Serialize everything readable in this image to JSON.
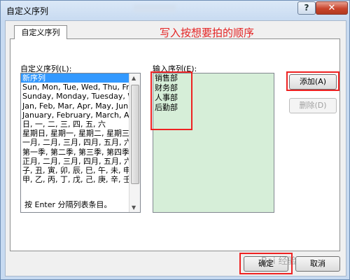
{
  "window": {
    "title": "自定义序列"
  },
  "titlebar_buttons": {
    "help": "?",
    "close": "✕"
  },
  "tab": {
    "label": "自定义序列"
  },
  "annotation": "写入按想要拍的顺序",
  "left_list": {
    "label": "自定义序列(L):",
    "items": [
      "新序列",
      "Sun, Mon, Tue, Wed, Thu, Fri, Sa",
      "Sunday, Monday, Tuesday, Wedne",
      "Jan, Feb, Mar, Apr, May, Jun, Ju",
      "January, February, March, April,",
      "日, 一, 二, 三, 四, 五, 六",
      "星期日, 星期一, 星期二, 星期三, 星",
      "一月, 二月, 三月, 四月, 五月, 六月,",
      "第一季, 第二季, 第三季, 第四季",
      "正月, 二月, 三月, 四月, 五月, 六月,",
      "子, 丑, 寅, 卯, 辰, 巳, 午, 未, 申, 酉",
      "甲, 乙, 丙, 丁, 戊, 己, 庚, 辛, 壬, 癸"
    ],
    "selected_index": 0
  },
  "entries": {
    "label": "输入序列(E):",
    "lines": [
      "销售部",
      "财务部",
      "人事部",
      "后勤部"
    ]
  },
  "buttons": {
    "add": "添加(A)",
    "delete": "删除(D)",
    "ok": "确定",
    "cancel": "取消"
  },
  "hint": "按 Enter 分隔列表条目。",
  "watermark": "Bai 经验",
  "colors": {
    "highlight": "#3399ff",
    "entries_bg": "#d6eed8",
    "annotation": "#e42424"
  }
}
